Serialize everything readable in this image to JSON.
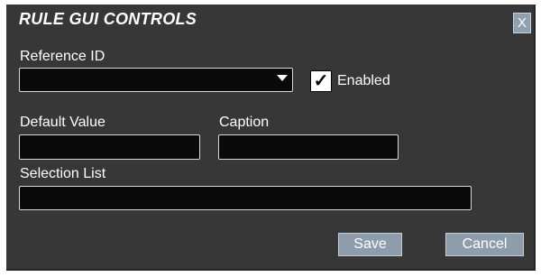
{
  "dialog": {
    "title": "RULE GUI CONTROLS",
    "close_label": "X"
  },
  "fields": {
    "reference_id": {
      "label": "Reference ID",
      "value": ""
    },
    "enabled": {
      "label": "Enabled",
      "checked": true,
      "check_glyph": "✓"
    },
    "default_value": {
      "label": "Default Value",
      "value": ""
    },
    "caption": {
      "label": "Caption",
      "value": ""
    },
    "selection_list": {
      "label": "Selection List",
      "value": ""
    }
  },
  "buttons": {
    "save": "Save",
    "cancel": "Cancel"
  },
  "icons": {
    "dropdown": "chevron-down-icon",
    "checkbox": "check-icon",
    "close": "close-icon"
  },
  "colors": {
    "panel_bg": "#373737",
    "field_bg": "#0a0a0a",
    "button_bg": "#8d9dab",
    "text": "#ffffff"
  }
}
